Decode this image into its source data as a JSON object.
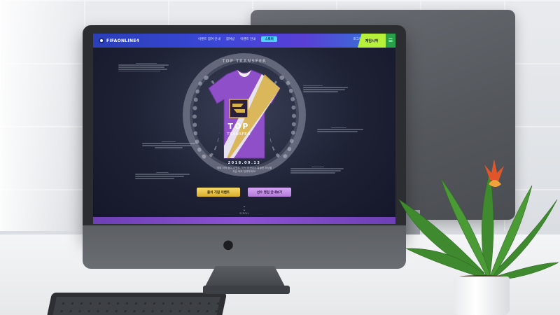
{
  "colors": {
    "nav_bar": "#3a47d6",
    "start_button": "#b6f03a",
    "gold_button": "#e2bb45",
    "purple_button": "#c28fe6",
    "jersey_purple": "#8e4fc8",
    "screen_bg": "#1d2133"
  },
  "site": {
    "brand": "FIFAONLINE4",
    "nav": [
      "이벤트 참여 안내",
      "참여방",
      "이벤트 안내"
    ],
    "nav_active": "스토어",
    "account": "로그아웃",
    "start_label": "게임시작",
    "menu_icon": "hamburger-icon"
  },
  "hero": {
    "ring_text": "TOP TRANSFER",
    "jersey_text_top": "TOP",
    "jersey_text_bottom": "TRANSFER",
    "date": "2018.09.13",
    "subtitle_line1": "최대 이적 참여 이벤트, 이적 마켓에서 특별한 보상을",
    "subtitle_line2": "지금 바로 참여하세요!",
    "btn_primary": "출석 기념 이벤트",
    "btn_secondary": "선수 영입 안내보기",
    "scroll_label": "SCROLL"
  },
  "decor": {
    "scroll_icon": "double-chevron-down-icon",
    "apple_icon": "apple-logo-icon",
    "plant_icon": "bromeliad-plant"
  }
}
